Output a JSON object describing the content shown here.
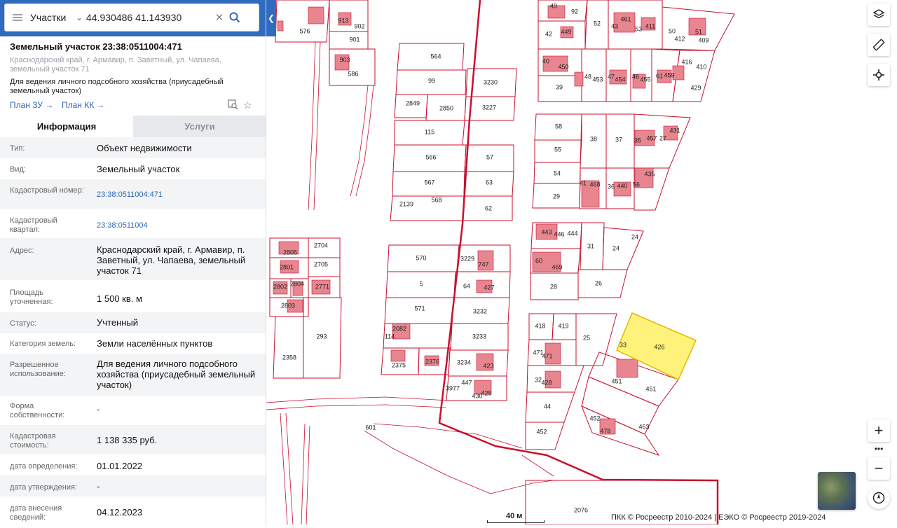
{
  "search": {
    "layer": "Участки",
    "query": "44.930486 41.143930"
  },
  "object": {
    "title": "Земельный участок 23:38:0511004:471",
    "address": "Краснодарский край, г. Армавир, п. Заветный, ул. Чапаева, земельный участок 71",
    "use": "Для ведения личного подсобного хозяйства (приусадебный земельный участок)",
    "plan_zu": "План ЗУ",
    "plan_kk": "План КК"
  },
  "tabs": [
    "Информация",
    "Услуги"
  ],
  "fields": [
    {
      "label": "Тип:",
      "value": "Объект недвижимости"
    },
    {
      "label": "Вид:",
      "value": "Земельный участок"
    },
    {
      "label": "Кадастровый номер:",
      "value": "23:38:0511004:471"
    },
    {
      "label": "Кадастровый квартал:",
      "value": "23:38:0511004"
    },
    {
      "label": "Адрес:",
      "value": "Краснодарский край, г. Армавир, п. Заветный, ул. Чапаева, земельный участок 71"
    },
    {
      "label": "Площадь уточненная:",
      "value": "1 500 кв. м"
    },
    {
      "label": "Статус:",
      "value": "Учтенный"
    },
    {
      "label": "Категория земель:",
      "value": "Земли населённых пунктов"
    },
    {
      "label": "Разрешенное использование:",
      "value": "Для ведения личного подсобного хозяйства (приусадебный земельный участок)"
    },
    {
      "label": "Форма собственности:",
      "value": "-"
    },
    {
      "label": "Кадастровая стоимость:",
      "value": "1 138 335 руб."
    },
    {
      "label": "дата определения:",
      "value": "01.01.2022"
    },
    {
      "label": "дата утверждения:",
      "value": "-"
    },
    {
      "label": "дата внесения сведений:",
      "value": "04.12.2023"
    }
  ],
  "map": {
    "scale": "40 м",
    "copyright": "ПКК © Росреестр 2010-2024 | ЕЭКО © Росреестр 2019-2024",
    "colors": {
      "boundary": "#c8102e",
      "building": "#e8858f",
      "selected": "#fff27a",
      "selected_border": "#e6b800"
    },
    "labels": [
      "576",
      "913",
      "902",
      "901",
      "903",
      "586",
      "564",
      "99",
      "3230",
      "2849",
      "2850",
      "3227",
      "115",
      "566",
      "57",
      "567",
      "63",
      "2139",
      "568",
      "62",
      "570",
      "3229",
      "747",
      "5",
      "64",
      "427",
      "571",
      "3232",
      "114",
      "2082",
      "3233",
      "2376",
      "2375",
      "3234",
      "423",
      "3977",
      "447",
      "430",
      "425",
      "601",
      "2076",
      "2805",
      "2704",
      "2801",
      "2705",
      "2802",
      "2804",
      "2771",
      "2803",
      "293",
      "2358",
      "49",
      "92",
      "52",
      "43",
      "461",
      "53",
      "411",
      "50",
      "51",
      "42",
      "449",
      "412",
      "409",
      "40",
      "450",
      "48",
      "453",
      "47",
      "454",
      "46",
      "455",
      "61",
      "459",
      "416",
      "410",
      "39",
      "429",
      "58",
      "38",
      "37",
      "35",
      "457",
      "27",
      "431",
      "55",
      "54",
      "41",
      "468",
      "36",
      "440",
      "56",
      "435",
      "29",
      "443",
      "446",
      "444",
      "31",
      "24",
      "24",
      "60",
      "469",
      "28",
      "26",
      "418",
      "419",
      "25",
      "33",
      "426",
      "471",
      "471",
      "32",
      "428",
      "451",
      "451",
      "44",
      "452",
      "463",
      "452",
      "478"
    ]
  }
}
